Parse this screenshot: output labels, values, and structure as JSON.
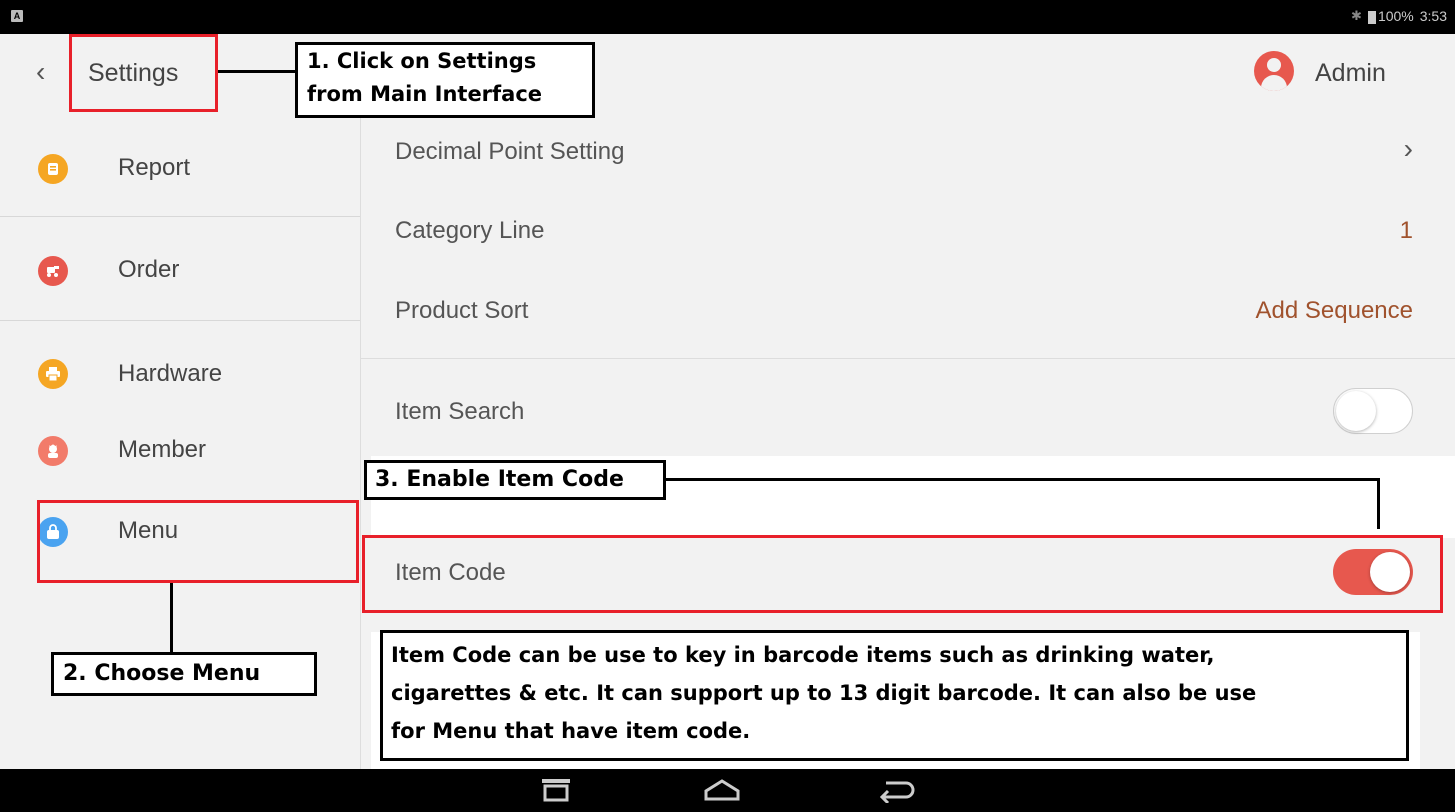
{
  "statusbar": {
    "left_icon": "A",
    "battery": "100%",
    "time": "3:53"
  },
  "header": {
    "back_icon": "chevron-left-icon",
    "title": "Settings",
    "user": "Admin"
  },
  "sidebar": {
    "items": [
      {
        "label": "Report",
        "icon": "report-icon",
        "color": "#f5a623"
      },
      {
        "label": "Order",
        "icon": "order-icon",
        "color": "#e7584e"
      },
      {
        "label": "Hardware",
        "icon": "printer-icon",
        "color": "#f5a623"
      },
      {
        "label": "Member",
        "icon": "member-icon",
        "color": "#f27b6a"
      },
      {
        "label": "Menu",
        "icon": "bag-icon",
        "color": "#4aa3f0"
      }
    ]
  },
  "settings": {
    "decimal_point": {
      "label": "Decimal Point Setting"
    },
    "category_line": {
      "label": "Category Line",
      "value": "1"
    },
    "product_sort": {
      "label": "Product Sort",
      "value": "Add Sequence"
    },
    "item_search": {
      "label": "Item Search",
      "enabled": false
    },
    "item_code": {
      "label": "Item Code",
      "enabled": true
    }
  },
  "annotations": {
    "step1_line1": "1. Click on Settings",
    "step1_line2": "from Main Interface",
    "step2": "2. Choose Menu",
    "step3": "3. Enable Item Code",
    "note_line1": "Item Code can be use to key in barcode items such as drinking water,",
    "note_line2": "cigarettes & etc. It can support up to 13 digit barcode. It can also be use",
    "note_line3": "for Menu that have item code."
  },
  "colors": {
    "accent": "#e7584e",
    "value_text": "#a0522d",
    "annotation_red": "#e8202a"
  }
}
